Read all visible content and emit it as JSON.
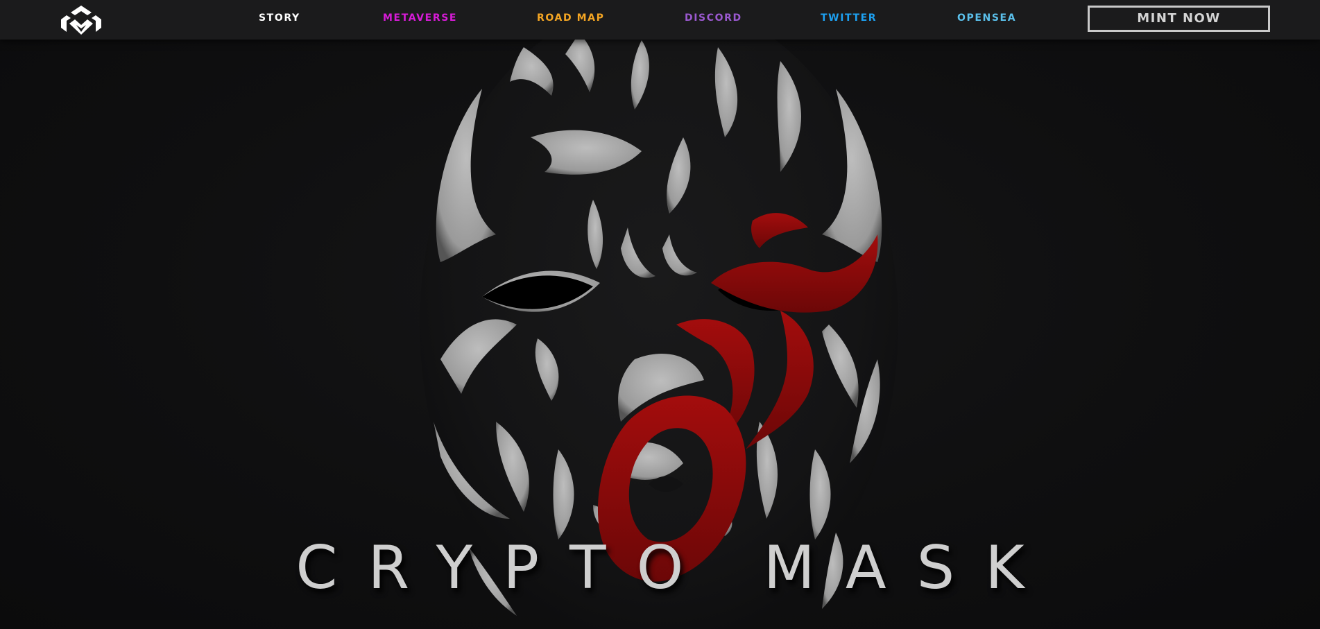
{
  "nav": {
    "logo_icon": "crypto-mask-logo-icon",
    "links": [
      {
        "label": "STORY",
        "color": "#ffffff"
      },
      {
        "label": "METAVERSE",
        "color": "#d81bd8"
      },
      {
        "label": "ROAD MAP",
        "color": "#f5a623"
      },
      {
        "label": "DISCORD",
        "color": "#9b59d0"
      },
      {
        "label": "TWITTER",
        "color": "#1da1f2"
      },
      {
        "label": "OPENSEA",
        "color": "#5bc0eb"
      }
    ],
    "mint_label": "MINT NOW"
  },
  "hero": {
    "title": "CRYPTO MASK",
    "mask_colors": {
      "pattern": "#a9a9a9",
      "accent": "#8e0a0a",
      "base": "#121213"
    }
  }
}
